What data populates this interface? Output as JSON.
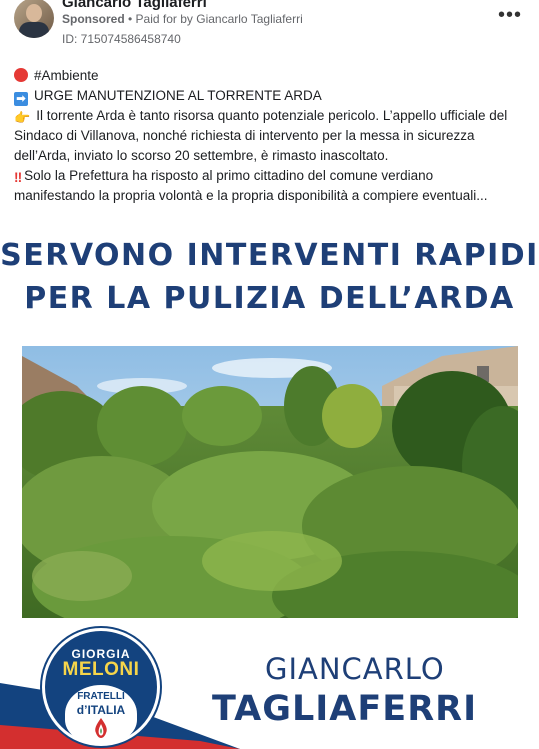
{
  "post": {
    "author": "Giancarlo Tagliaferri",
    "sponsored_label": "Sponsored",
    "separator": " • ",
    "paid_for_prefix": "Paid for by ",
    "paid_for_name": "Giancarlo Tagliaferri",
    "ad_id": "ID: 715074586458740",
    "more_icon": "more-horizontal-icon"
  },
  "body": {
    "line1": "#Ambiente",
    "line2": "URGE MANUTENZIONE AL TORRENTE ARDA",
    "line3": "Il torrente Arda è tanto risorsa quanto potenziale pericolo. L’appello ufficiale del",
    "line4": "Sindaco di Villanova, nonché richiesta di intervento per la messa in sicurezza",
    "line5": "dell’Arda, inviato lo scorso 20 settembre, è rimasto inascoltato.",
    "line6": "Solo la Prefettura ha risposto al primo cittadino del comune verdiano",
    "line7": "manifestando la propria volontà e la propria disponibilità a compiere eventuali...",
    "emoji1": "red-circle-icon",
    "emoji2": "right-arrow-icon",
    "emoji3": "pointing-hand-icon",
    "emoji4": "double-exclamation-icon",
    "arrow_glyph": "➡",
    "hand_glyph": "👉",
    "bang_glyph": "‼"
  },
  "creative": {
    "headline1": "SERVONO INTERVENTI RAPIDI",
    "headline2": "PER LA PULIZIA DELL’ARDA",
    "logo": {
      "giorgia": "GIORGIA",
      "meloni": "MELONI",
      "fratelli": "FRATELLI",
      "italia": "d’ITALIA"
    },
    "candidate_first": "GIANCARLO",
    "candidate_last": "TAGLIAFERRI",
    "colors": {
      "navy": "#1e3f77",
      "band": "#13437f",
      "red": "#d32f2f",
      "yellow": "#f6d54a"
    }
  }
}
